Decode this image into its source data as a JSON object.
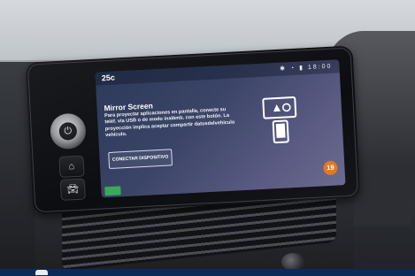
{
  "status_bar": {
    "temperature": "25c",
    "icons": [
      "bluetooth-icon",
      "wifi-icon",
      "signal-icon",
      "clock-icon"
    ],
    "time": "18:00"
  },
  "screen": {
    "title": "Mirror Screen",
    "description": "Para proyectar aplicaciones en pantalla, conecte su teléf. vía USB o de modo inalámb. con este botón. La proyección implica aceptar compartir datosdelvehículo vehículo.",
    "button_label": "CONECTAR DISPOSITIVO",
    "graphic": "mirror-screen-icon",
    "badge_number": "19"
  },
  "hardware": {
    "knob_icon": "power-icon",
    "buttons": [
      "home-icon",
      "car-icon"
    ]
  },
  "colors": {
    "screen_bg": "#3a4466",
    "badge": "#e07a24",
    "accent_green": "#3aa95a"
  }
}
